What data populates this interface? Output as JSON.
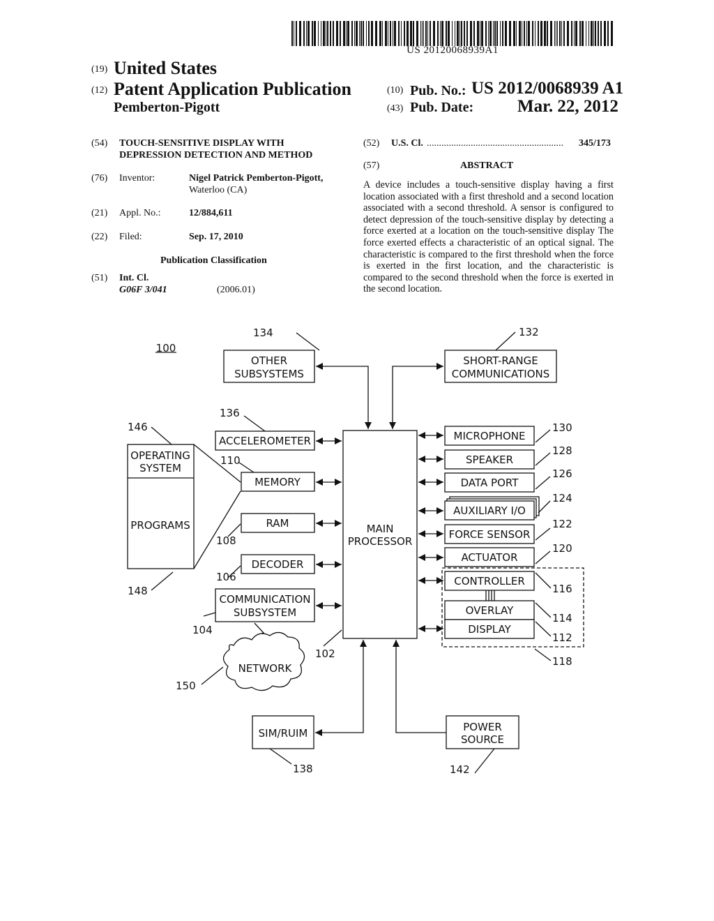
{
  "header": {
    "barcode_text": "US 20120068939A1",
    "country_code": "(19)",
    "country": "United States",
    "doc_type_code": "(12)",
    "doc_type": "Patent Application Publication",
    "applicant_short": "Pemberton-Pigott",
    "pub_no_code": "(10)",
    "pub_no_label": "Pub. No.:",
    "pub_no": "US 2012/0068939 A1",
    "pub_date_code": "(43)",
    "pub_date_label": "Pub. Date:",
    "pub_date": "Mar. 22, 2012"
  },
  "biblio": {
    "title_code": "(54)",
    "title_line1": "TOUCH-SENSITIVE DISPLAY WITH",
    "title_line2": "DEPRESSION DETECTION AND METHOD",
    "inventor_code": "(76)",
    "inventor_label": "Inventor:",
    "inventor_name": "Nigel Patrick Pemberton-Pigott,",
    "inventor_location": "Waterloo (CA)",
    "appl_code": "(21)",
    "appl_label": "Appl. No.:",
    "appl_no": "12/884,611",
    "filed_code": "(22)",
    "filed_label": "Filed:",
    "filed_date": "Sep. 17, 2010",
    "pub_class_heading": "Publication Classification",
    "int_cl_code": "(51)",
    "int_cl_label": "Int. Cl.",
    "int_cl_value": "G06F 3/041",
    "int_cl_version": "(2006.01)",
    "us_cl_code": "(52)",
    "us_cl_label": "U.S. Cl.",
    "us_cl_dots": "........................................................",
    "us_cl_value": "345/173"
  },
  "abstract": {
    "code": "(57)",
    "heading": "ABSTRACT",
    "text": "A device includes a touch-sensitive display having a first location associated with a first threshold and a second location associated with a second threshold. A sensor is configured to detect depression of the touch-sensitive display by detecting a force exerted at a location on the touch-sensitive display The force exerted effects a characteristic of an optical signal. The characteristic is compared to the first threshold when the force is exerted in the first location, and the characteristic is compared to the second threshold when the force is exerted in the second location."
  },
  "diagram": {
    "figure_ref": "100",
    "main_processor": {
      "line1": "MAIN",
      "line2": "PROCESSOR",
      "ref": "102"
    },
    "other_subsystems": {
      "line1": "OTHER",
      "line2": "SUBSYSTEMS",
      "ref": "134"
    },
    "short_range": {
      "line1": "SHORT-RANGE",
      "line2": "COMMUNICATIONS",
      "ref": "132"
    },
    "accelerometer": {
      "label": "ACCELEROMETER",
      "ref": "136"
    },
    "memory": {
      "label": "MEMORY",
      "ref": "110"
    },
    "ram": {
      "label": "RAM",
      "ref": "108"
    },
    "decoder": {
      "label": "DECODER",
      "ref": "106"
    },
    "comm_subsystem": {
      "line1": "COMMUNICATION",
      "line2": "SUBSYSTEM",
      "ref": "104"
    },
    "operating_system": {
      "line1": "OPERATING",
      "line2": "SYSTEM",
      "ref": "146"
    },
    "programs": {
      "label": "PROGRAMS",
      "ref": "148"
    },
    "network": {
      "label": "NETWORK",
      "ref": "150"
    },
    "sim": {
      "label": "SIM/RUIM",
      "ref": "138"
    },
    "power": {
      "line1": "POWER",
      "line2": "SOURCE",
      "ref": "142"
    },
    "microphone": {
      "label": "MICROPHONE",
      "ref": "130"
    },
    "speaker": {
      "label": "SPEAKER",
      "ref": "128"
    },
    "data_port": {
      "label": "DATA PORT",
      "ref": "126"
    },
    "aux_io": {
      "label": "AUXILIARY I/O",
      "ref": "124"
    },
    "force_sensor": {
      "label": "FORCE SENSOR",
      "ref": "122"
    },
    "actuator": {
      "label": "ACTUATOR",
      "ref": "120"
    },
    "controller": {
      "label": "CONTROLLER",
      "ref": "116"
    },
    "overlay": {
      "label": "OVERLAY",
      "ref": "114"
    },
    "display": {
      "label": "DISPLAY",
      "ref": "112"
    },
    "touch_display_group": {
      "ref": "118"
    }
  }
}
